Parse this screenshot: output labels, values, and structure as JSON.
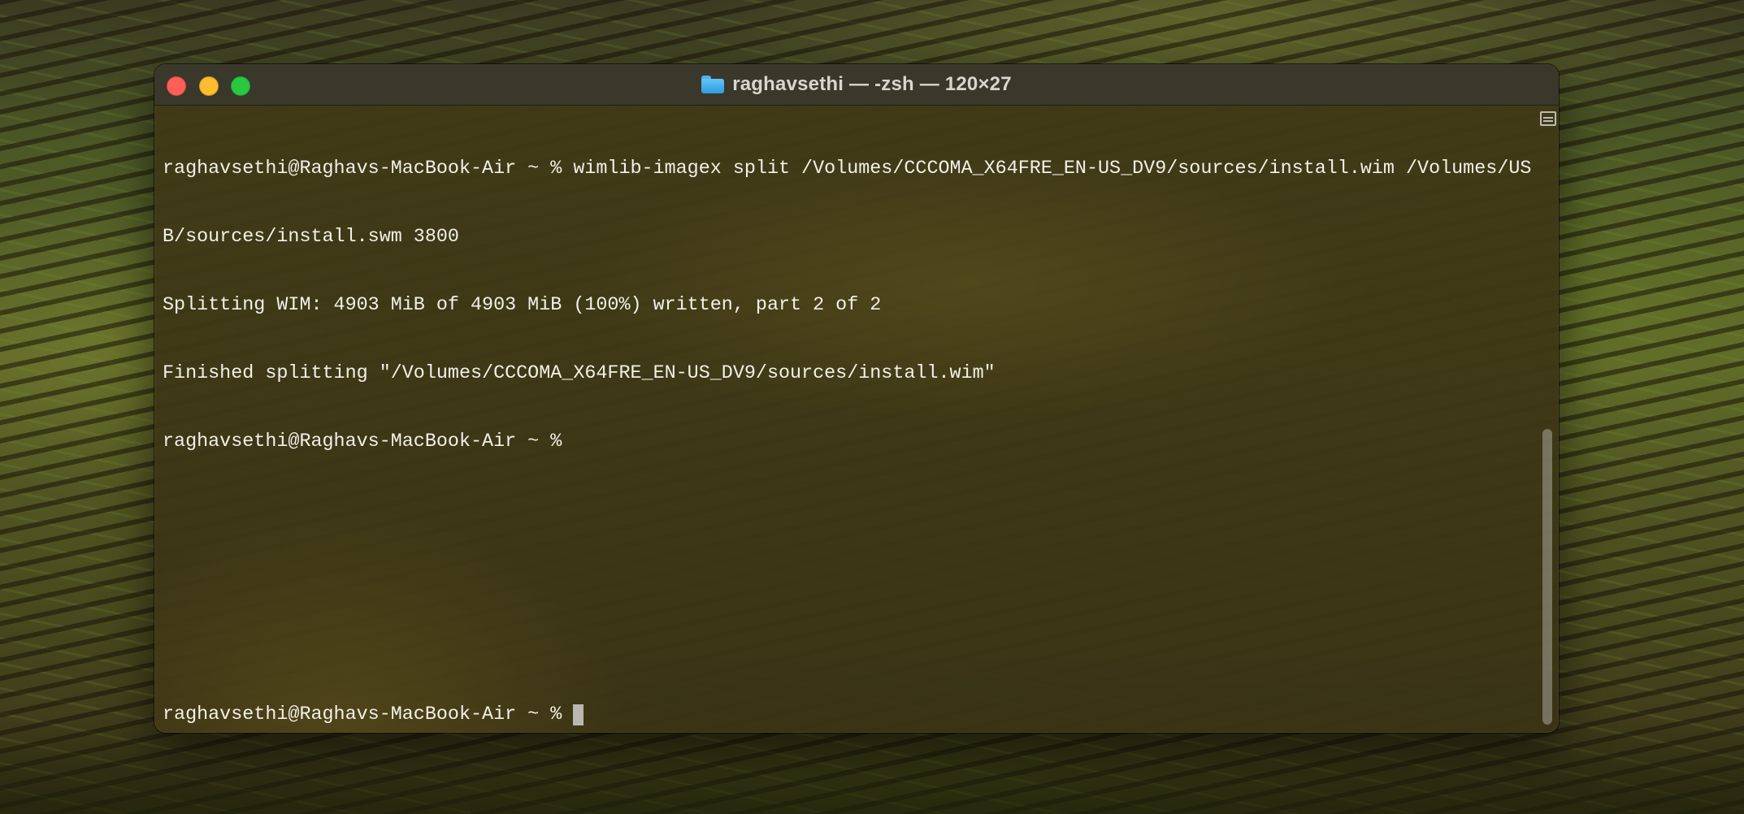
{
  "window": {
    "title": "raghavsethi — -zsh — 120×27",
    "title_icon": "folder-icon",
    "traffic_lights": {
      "close_color": "#ff5f57",
      "minimize_color": "#febc2e",
      "zoom_color": "#28c840"
    }
  },
  "terminal": {
    "lines": [
      "raghavsethi@Raghavs-MacBook-Air ~ % wimlib-imagex split /Volumes/CCCOMA_X64FRE_EN-US_DV9/sources/install.wim /Volumes/US",
      "B/sources/install.swm 3800",
      "Splitting WIM: 4903 MiB of 4903 MiB (100%) written, part 2 of 2",
      "Finished splitting \"/Volumes/CCCOMA_X64FRE_EN-US_DV9/sources/install.wim\"",
      "raghavsethi@Raghavs-MacBook-Air ~ %"
    ],
    "current_prompt": "raghavsethi@Raghavs-MacBook-Air ~ %"
  }
}
